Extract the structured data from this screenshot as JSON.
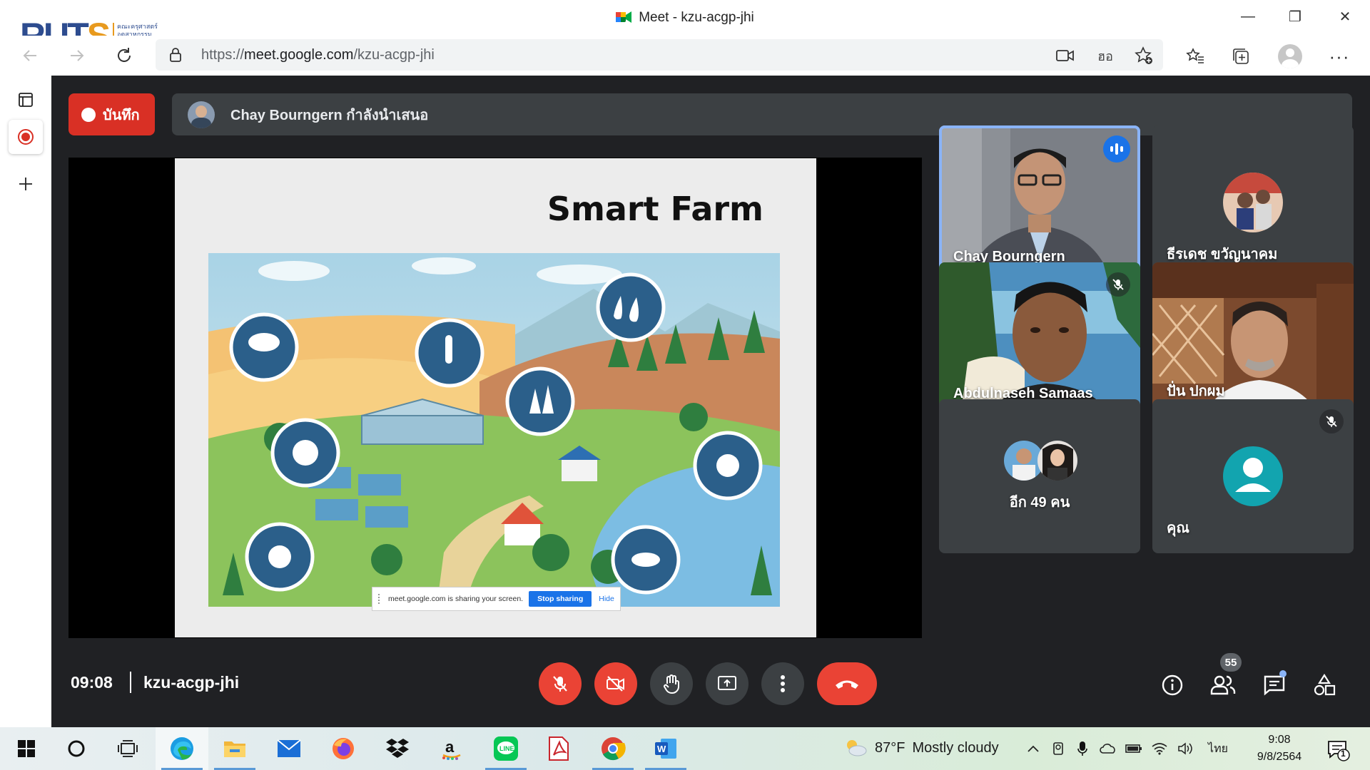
{
  "window": {
    "title": "Meet - kzu-acgp-jhi",
    "minimize": "—",
    "restore": "❐",
    "close": "✕"
  },
  "logo": {
    "text_main": "RUT",
    "text_accent": "S",
    "subtitle": "คณะครุศาสตร์ อุตสาหกรรมและเทคโนโลยี"
  },
  "address": {
    "url_scheme": "https://",
    "url_host": "meet.google.com",
    "url_path": "/kzu-acgp-jhi"
  },
  "meet": {
    "record_label": "บันทึก",
    "presenting_text": "Chay Bourngern กำลังนำเสนอ",
    "slide": {
      "title": "Smart Farm",
      "share_notice": "meet.google.com is sharing your screen.",
      "stop_sharing": "Stop sharing",
      "hide": "Hide"
    },
    "participants": [
      {
        "name": "Chay Bourngern",
        "speaking": true
      },
      {
        "name": "ธีรเดช ขวัญนาคม"
      },
      {
        "name": "Abdulnaseh Samaas",
        "muted": true
      },
      {
        "name": "ปั่น ปกผม"
      },
      {
        "name": "อีก 49 คน"
      },
      {
        "name": "คุณ",
        "muted": true
      }
    ],
    "time": "09:08",
    "meeting_code": "kzu-acgp-jhi",
    "people_count": "55"
  },
  "taskbar": {
    "weather_temp": "87°F",
    "weather_text": "Mostly cloudy",
    "language": "ไทย",
    "time": "9:08",
    "date": "9/8/2564",
    "notification_count": "1"
  },
  "colors": {
    "meet_bg": "#202124",
    "tile_bg": "#3c4043",
    "danger": "#ea4335",
    "record": "#d93025",
    "speaking_outline": "#8ab4f8"
  }
}
